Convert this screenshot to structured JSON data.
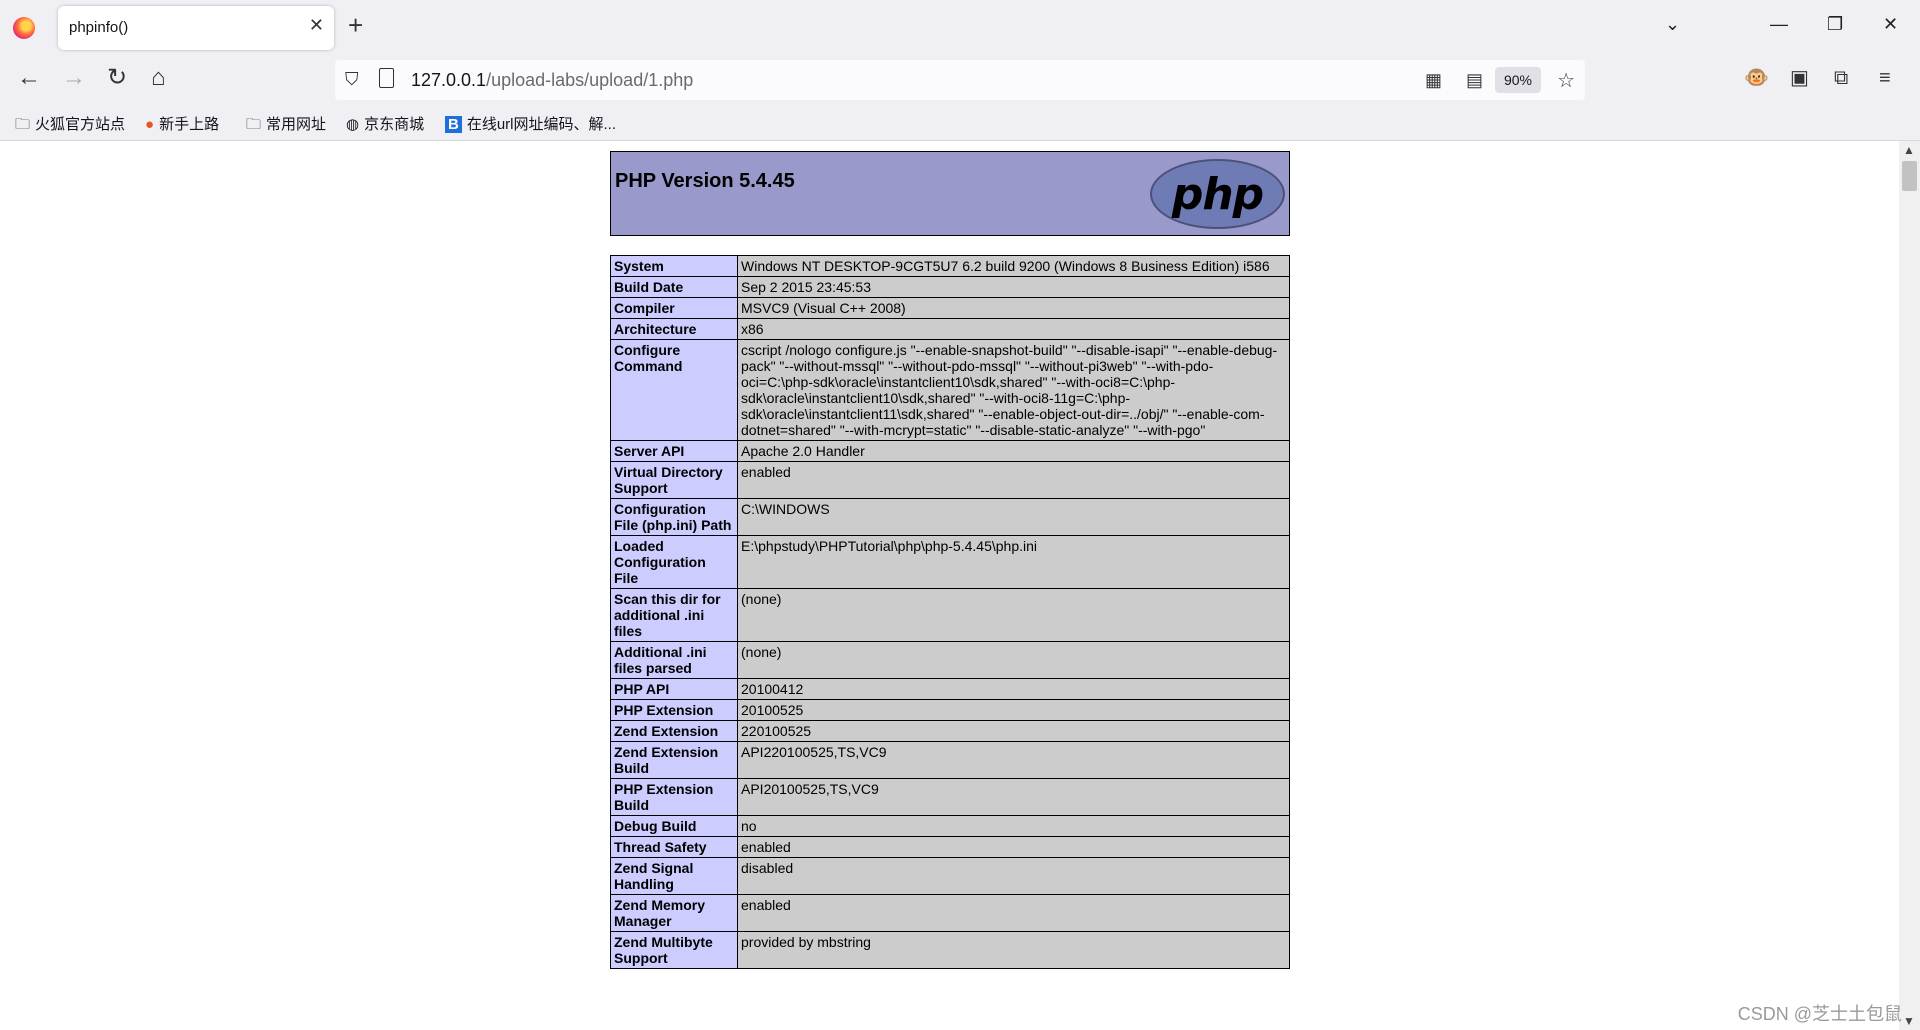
{
  "browser": {
    "tab_title": "phpinfo()",
    "url_host": "127.0.0.1",
    "url_path": "/upload-labs/upload/1.php",
    "zoom": "90%",
    "bookmarks": [
      {
        "icon": "folder-icon",
        "label": "火狐官方站点"
      },
      {
        "icon": "firefox-icon",
        "label": "新手上路"
      },
      {
        "icon": "folder-icon",
        "label": "常用网址"
      },
      {
        "icon": "globe-icon",
        "label": "京东商城"
      },
      {
        "icon": "b-icon",
        "label": "在线url网址编码、解..."
      }
    ]
  },
  "page": {
    "php_version": "PHP Version 5.4.45",
    "logo_text": "php",
    "rows": [
      {
        "label": "System",
        "value": "Windows NT DESKTOP-9CGT5U7 6.2 build 9200 (Windows 8 Business Edition) i586"
      },
      {
        "label": "Build Date",
        "value": "Sep 2 2015 23:45:53"
      },
      {
        "label": "Compiler",
        "value": "MSVC9 (Visual C++ 2008)"
      },
      {
        "label": "Architecture",
        "value": "x86"
      },
      {
        "label": "Configure Command",
        "value": "cscript /nologo configure.js \"--enable-snapshot-build\" \"--disable-isapi\" \"--enable-debug-pack\" \"--without-mssql\" \"--without-pdo-mssql\" \"--without-pi3web\" \"--with-pdo-oci=C:\\php-sdk\\oracle\\instantclient10\\sdk,shared\" \"--with-oci8=C:\\php-sdk\\oracle\\instantclient10\\sdk,shared\" \"--with-oci8-11g=C:\\php-sdk\\oracle\\instantclient11\\sdk,shared\" \"--enable-object-out-dir=../obj/\" \"--enable-com-dotnet=shared\" \"--with-mcrypt=static\" \"--disable-static-analyze\" \"--with-pgo\""
      },
      {
        "label": "Server API",
        "value": "Apache 2.0 Handler"
      },
      {
        "label": "Virtual Directory Support",
        "value": "enabled"
      },
      {
        "label": "Configuration File (php.ini) Path",
        "value": "C:\\WINDOWS"
      },
      {
        "label": "Loaded Configuration File",
        "value": "E:\\phpstudy\\PHPTutorial\\php\\php-5.4.45\\php.ini"
      },
      {
        "label": "Scan this dir for additional .ini files",
        "value": "(none)"
      },
      {
        "label": "Additional .ini files parsed",
        "value": "(none)"
      },
      {
        "label": "PHP API",
        "value": "20100412"
      },
      {
        "label": "PHP Extension",
        "value": "20100525"
      },
      {
        "label": "Zend Extension",
        "value": "220100525"
      },
      {
        "label": "Zend Extension Build",
        "value": "API220100525,TS,VC9"
      },
      {
        "label": "PHP Extension Build",
        "value": "API20100525,TS,VC9"
      },
      {
        "label": "Debug Build",
        "value": "no"
      },
      {
        "label": "Thread Safety",
        "value": "enabled"
      },
      {
        "label": "Zend Signal Handling",
        "value": "disabled"
      },
      {
        "label": "Zend Memory Manager",
        "value": "enabled"
      },
      {
        "label": "Zend Multibyte Support",
        "value": "provided by mbstring"
      }
    ]
  },
  "watermark": "CSDN @芝士土包鼠"
}
